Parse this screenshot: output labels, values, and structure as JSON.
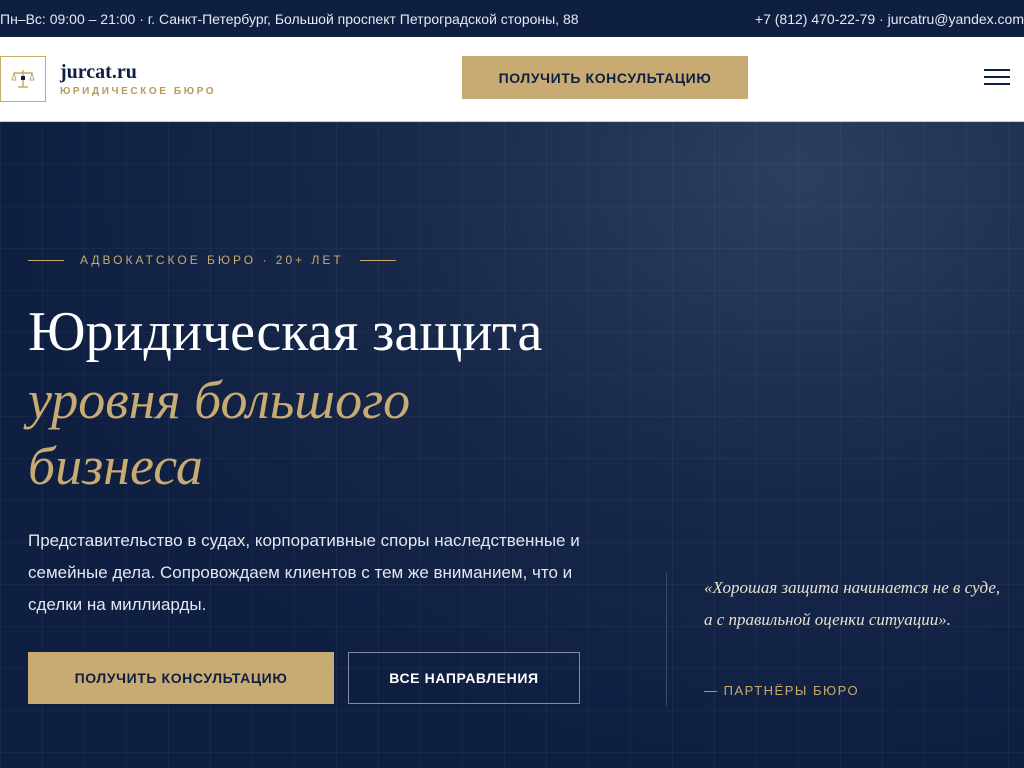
{
  "topbar": {
    "left_text": "Пн–Вс: 09:00 – 21:00 · г. Санкт-Петербург, Большой проспект Петроградской стороны, 88",
    "right_text": "+7 (812) 470-22-79 · jurcatru@yandex.com"
  },
  "header": {
    "logo_icon": "scales-of-justice-icon",
    "logo_name": "jurcat.ru",
    "logo_sub": "ЮРИДИЧЕСКОЕ БЮРО",
    "cta_label": "ПОЛУЧИТЬ КОНСУЛЬТАЦИЮ",
    "menu_icon": "hamburger-menu-icon"
  },
  "hero": {
    "eyebrow": "АДВОКАТСКОЕ БЮРО · 20+ ЛЕТ",
    "title_line1": "Юридическая защита",
    "title_accent": "уровня большого бизнеса",
    "lead": "Представительство в судах, корпоративные споры наследственные и семейные дела. Сопровождаем клиентов с тем же вниманием, что и сделки на миллиарды.",
    "primary_button": "ПОЛУЧИТЬ КОНСУЛЬТАЦИЮ",
    "secondary_button": "ВСЕ НАПРАВЛЕНИЯ",
    "quote": "«Хорошая защита начинается не в суде, а с правильной оценки ситуации».",
    "quote_author": "— ПАРТНЁРЫ БЮРО"
  },
  "colors": {
    "navy": "#0f1f42",
    "gold": "#c8ab72",
    "white": "#ffffff"
  }
}
